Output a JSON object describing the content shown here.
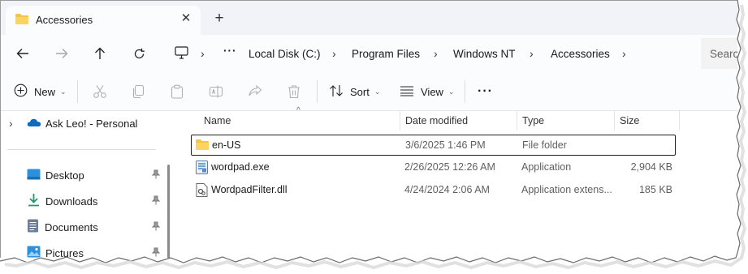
{
  "window": {
    "tab_title": "Accessories",
    "tab_close": "✕",
    "new_tab": "+"
  },
  "nav_buttons": [
    "back-icon",
    "forward-icon",
    "up-icon",
    "refresh-icon"
  ],
  "address": {
    "more": "···",
    "crumbs": [
      "Local Disk (C:)",
      "Program Files",
      "Windows NT",
      "Accessories"
    ],
    "separator": "›"
  },
  "search": {
    "placeholder": "Searc"
  },
  "toolbar": {
    "new_label": "New",
    "sort_label": "Sort",
    "view_label": "View",
    "more_label": "···",
    "caret": "⌄"
  },
  "nav_pane": {
    "expand_caret": "›",
    "top_item": "Ask Leo! - Personal",
    "items": [
      {
        "label": "Desktop",
        "icon": "desktop-icon",
        "pinned": true
      },
      {
        "label": "Downloads",
        "icon": "downloads-icon",
        "pinned": true
      },
      {
        "label": "Documents",
        "icon": "documents-icon",
        "pinned": true
      },
      {
        "label": "Pictures",
        "icon": "pictures-icon",
        "pinned": true
      }
    ]
  },
  "columns": {
    "sort_indicator": "^",
    "name": "Name",
    "date": "Date modified",
    "type": "Type",
    "size": "Size"
  },
  "files": [
    {
      "name": "en-US",
      "date": "3/6/2025 1:46 PM",
      "type": "File folder",
      "size": "",
      "icon": "folder-icon",
      "selected": true
    },
    {
      "name": "wordpad.exe",
      "date": "2/26/2025 12:26 AM",
      "type": "Application",
      "size": "2,904 KB",
      "icon": "application-icon",
      "selected": false
    },
    {
      "name": "WordpadFilter.dll",
      "date": "4/24/2024 2:06 AM",
      "type": "Application extens...",
      "size": "185 KB",
      "icon": "dll-file-icon",
      "selected": false
    }
  ],
  "colors": {
    "folder": "#f4c542",
    "accent": "#0067c0",
    "titlebar": "#f1f3f9"
  }
}
